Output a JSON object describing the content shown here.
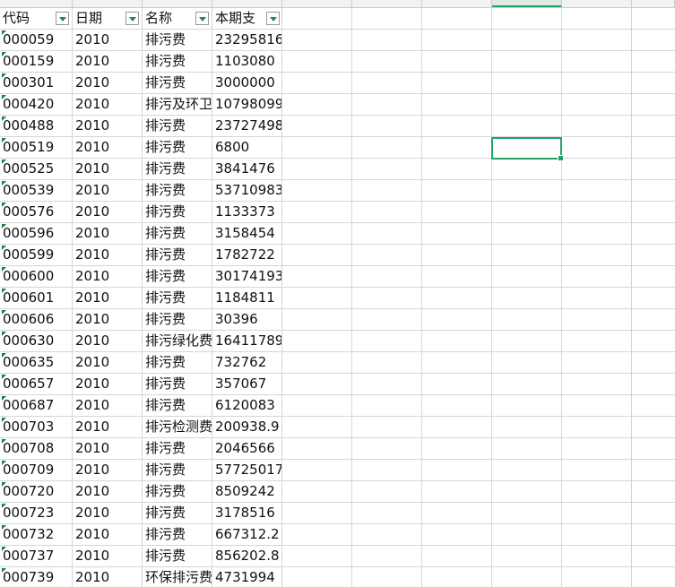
{
  "accent_color": "#21a366",
  "header": {
    "code": "代码",
    "year": "日期",
    "name": "名称",
    "amount": "本期支"
  },
  "rows": [
    {
      "code": "000059",
      "year": "2010",
      "name": "排污费",
      "amount": "23295816"
    },
    {
      "code": "000159",
      "year": "2010",
      "name": "排污费",
      "amount": "1103080"
    },
    {
      "code": "000301",
      "year": "2010",
      "name": "排污费",
      "amount": "3000000"
    },
    {
      "code": "000420",
      "year": "2010",
      "name": "排污及环卫",
      "amount": "10798099"
    },
    {
      "code": "000488",
      "year": "2010",
      "name": "排污费",
      "amount": "23727498"
    },
    {
      "code": "000519",
      "year": "2010",
      "name": "排污费",
      "amount": "6800"
    },
    {
      "code": "000525",
      "year": "2010",
      "name": "排污费",
      "amount": "3841476"
    },
    {
      "code": "000539",
      "year": "2010",
      "name": "排污费",
      "amount": "53710983"
    },
    {
      "code": "000576",
      "year": "2010",
      "name": "排污费",
      "amount": "1133373"
    },
    {
      "code": "000596",
      "year": "2010",
      "name": "排污费",
      "amount": "3158454"
    },
    {
      "code": "000599",
      "year": "2010",
      "name": "排污费",
      "amount": "1782722"
    },
    {
      "code": "000600",
      "year": "2010",
      "name": "排污费",
      "amount": "30174193"
    },
    {
      "code": "000601",
      "year": "2010",
      "name": "排污费",
      "amount": "1184811"
    },
    {
      "code": "000606",
      "year": "2010",
      "name": "排污费",
      "amount": "30396"
    },
    {
      "code": "000630",
      "year": "2010",
      "name": "排污绿化费",
      "amount": "16411789"
    },
    {
      "code": "000635",
      "year": "2010",
      "name": "排污费",
      "amount": "732762"
    },
    {
      "code": "000657",
      "year": "2010",
      "name": "排污费",
      "amount": "357067"
    },
    {
      "code": "000687",
      "year": "2010",
      "name": "排污费",
      "amount": "6120083"
    },
    {
      "code": "000703",
      "year": "2010",
      "name": "排污检测费",
      "amount": "200938.9"
    },
    {
      "code": "000708",
      "year": "2010",
      "name": "排污费",
      "amount": "2046566"
    },
    {
      "code": "000709",
      "year": "2010",
      "name": "排污费",
      "amount": "57725017"
    },
    {
      "code": "000720",
      "year": "2010",
      "name": "排污费",
      "amount": "8509242"
    },
    {
      "code": "000723",
      "year": "2010",
      "name": "排污费",
      "amount": "3178516"
    },
    {
      "code": "000732",
      "year": "2010",
      "name": "排污费",
      "amount": "667312.2"
    },
    {
      "code": "000737",
      "year": "2010",
      "name": "排污费",
      "amount": "856202.8"
    },
    {
      "code": "000739",
      "year": "2010",
      "name": "环保排污费",
      "amount": "4731994"
    }
  ]
}
